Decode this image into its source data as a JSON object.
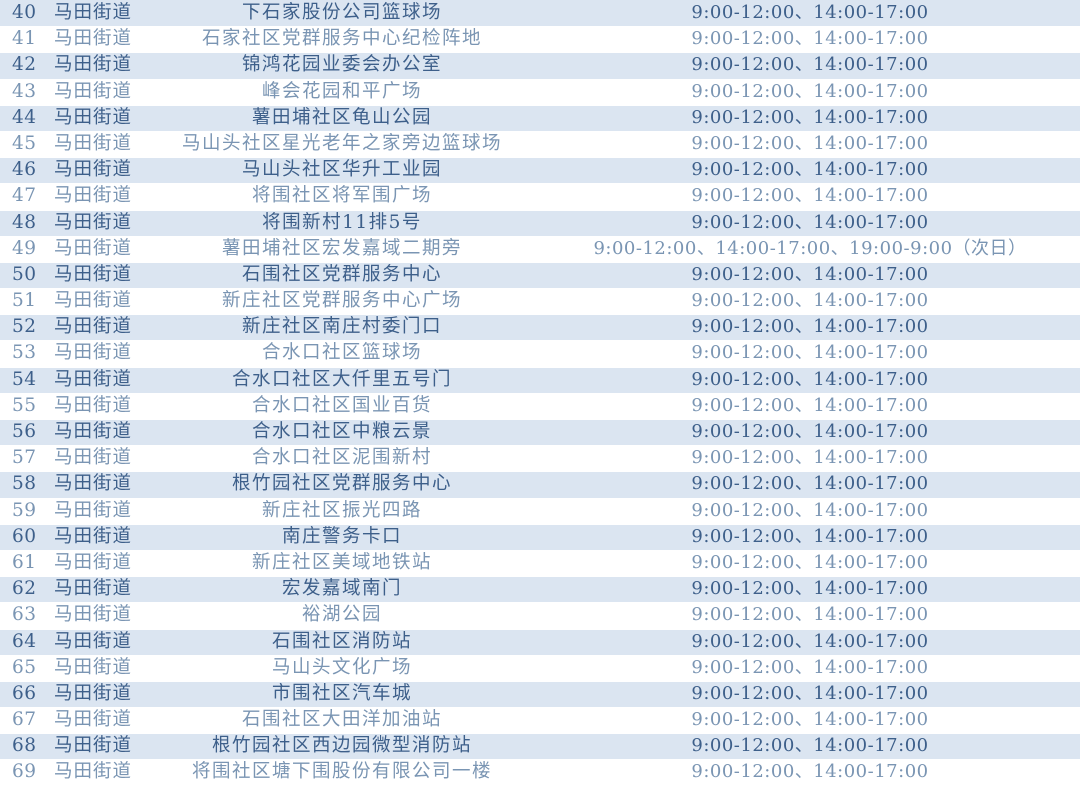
{
  "colors": {
    "shaded_row_bg": "#dbe5f1",
    "plain_row_bg": "#ffffff",
    "shaded_text": "#3d5f8a",
    "plain_text": "#7a95b3"
  },
  "table": {
    "rows": [
      {
        "no": "40",
        "street": "马田街道",
        "place": "下石家股份公司篮球场",
        "hours": "9:00-12:00、14:00-17:00"
      },
      {
        "no": "41",
        "street": "马田街道",
        "place": "石家社区党群服务中心纪检阵地",
        "hours": "9:00-12:00、14:00-17:00"
      },
      {
        "no": "42",
        "street": "马田街道",
        "place": "锦鸿花园业委会办公室",
        "hours": "9:00-12:00、14:00-17:00"
      },
      {
        "no": "43",
        "street": "马田街道",
        "place": "峰会花园和平广场",
        "hours": "9:00-12:00、14:00-17:00"
      },
      {
        "no": "44",
        "street": "马田街道",
        "place": "薯田埔社区龟山公园",
        "hours": "9:00-12:00、14:00-17:00"
      },
      {
        "no": "45",
        "street": "马田街道",
        "place": "马山头社区星光老年之家旁边篮球场",
        "hours": "9:00-12:00、14:00-17:00"
      },
      {
        "no": "46",
        "street": "马田街道",
        "place": "马山头社区华升工业园",
        "hours": "9:00-12:00、14:00-17:00"
      },
      {
        "no": "47",
        "street": "马田街道",
        "place": "将围社区将军围广场",
        "hours": "9:00-12:00、14:00-17:00"
      },
      {
        "no": "48",
        "street": "马田街道",
        "place": "将围新村11排5号",
        "hours": "9:00-12:00、14:00-17:00"
      },
      {
        "no": "49",
        "street": "马田街道",
        "place": "薯田埔社区宏发嘉域二期旁",
        "hours": "9:00-12:00、14:00-17:00、19:00-9:00（次日）"
      },
      {
        "no": "50",
        "street": "马田街道",
        "place": "石围社区党群服务中心",
        "hours": "9:00-12:00、14:00-17:00"
      },
      {
        "no": "51",
        "street": "马田街道",
        "place": "新庄社区党群服务中心广场",
        "hours": "9:00-12:00、14:00-17:00"
      },
      {
        "no": "52",
        "street": "马田街道",
        "place": "新庄社区南庄村委门口",
        "hours": "9:00-12:00、14:00-17:00"
      },
      {
        "no": "53",
        "street": "马田街道",
        "place": "合水口社区篮球场",
        "hours": "9:00-12:00、14:00-17:00"
      },
      {
        "no": "54",
        "street": "马田街道",
        "place": "合水口社区大仟里五号门",
        "hours": "9:00-12:00、14:00-17:00"
      },
      {
        "no": "55",
        "street": "马田街道",
        "place": "合水口社区国业百货",
        "hours": "9:00-12:00、14:00-17:00"
      },
      {
        "no": "56",
        "street": "马田街道",
        "place": "合水口社区中粮云景",
        "hours": "9:00-12:00、14:00-17:00"
      },
      {
        "no": "57",
        "street": "马田街道",
        "place": "合水口社区泥围新村",
        "hours": "9:00-12:00、14:00-17:00"
      },
      {
        "no": "58",
        "street": "马田街道",
        "place": "根竹园社区党群服务中心",
        "hours": "9:00-12:00、14:00-17:00"
      },
      {
        "no": "59",
        "street": "马田街道",
        "place": "新庄社区振光四路",
        "hours": "9:00-12:00、14:00-17:00"
      },
      {
        "no": "60",
        "street": "马田街道",
        "place": "南庄警务卡口",
        "hours": "9:00-12:00、14:00-17:00"
      },
      {
        "no": "61",
        "street": "马田街道",
        "place": "新庄社区美域地铁站",
        "hours": "9:00-12:00、14:00-17:00"
      },
      {
        "no": "62",
        "street": "马田街道",
        "place": "宏发嘉域南门",
        "hours": "9:00-12:00、14:00-17:00"
      },
      {
        "no": "63",
        "street": "马田街道",
        "place": "裕湖公园",
        "hours": "9:00-12:00、14:00-17:00"
      },
      {
        "no": "64",
        "street": "马田街道",
        "place": "石围社区消防站",
        "hours": "9:00-12:00、14:00-17:00"
      },
      {
        "no": "65",
        "street": "马田街道",
        "place": "马山头文化广场",
        "hours": "9:00-12:00、14:00-17:00"
      },
      {
        "no": "66",
        "street": "马田街道",
        "place": "市围社区汽车城",
        "hours": "9:00-12:00、14:00-17:00"
      },
      {
        "no": "67",
        "street": "马田街道",
        "place": "石围社区大田洋加油站",
        "hours": "9:00-12:00、14:00-17:00"
      },
      {
        "no": "68",
        "street": "马田街道",
        "place": "根竹园社区西边园微型消防站",
        "hours": "9:00-12:00、14:00-17:00"
      },
      {
        "no": "69",
        "street": "马田街道",
        "place": "将围社区塘下围股份有限公司一楼",
        "hours": "9:00-12:00、14:00-17:00"
      }
    ]
  }
}
